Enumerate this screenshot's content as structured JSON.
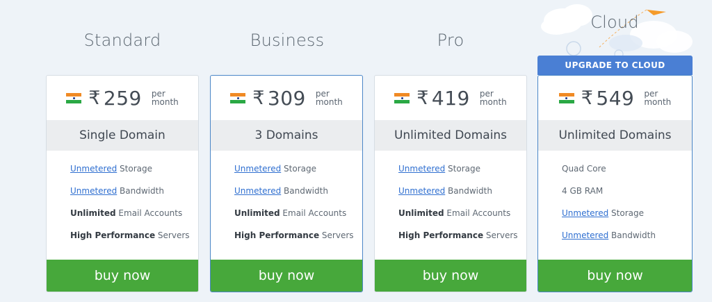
{
  "plans": [
    {
      "title": "Standard",
      "price": "259",
      "currency": "₹",
      "per_line1": "per",
      "per_line2": "month",
      "domains": "Single Domain",
      "features": [
        {
          "em": "Unmetered",
          "rest": " Storage",
          "style": "link"
        },
        {
          "em": "Unmetered",
          "rest": " Bandwidth",
          "style": "link"
        },
        {
          "em": "Unlimited",
          "rest": " Email Accounts",
          "style": "bold"
        },
        {
          "em": "High Performance",
          "rest": " Servers",
          "style": "bold"
        }
      ],
      "button": "buy now"
    },
    {
      "title": "Business",
      "price": "309",
      "currency": "₹",
      "per_line1": "per",
      "per_line2": "month",
      "domains": "3 Domains",
      "features": [
        {
          "em": "Unmetered",
          "rest": " Storage",
          "style": "link"
        },
        {
          "em": "Unmetered",
          "rest": " Bandwidth",
          "style": "link"
        },
        {
          "em": "Unlimited",
          "rest": " Email Accounts",
          "style": "bold"
        },
        {
          "em": "High Performance",
          "rest": " Servers",
          "style": "bold"
        }
      ],
      "button": "buy now"
    },
    {
      "title": "Pro",
      "price": "419",
      "currency": "₹",
      "per_line1": "per",
      "per_line2": "month",
      "domains": "Unlimited Domains",
      "features": [
        {
          "em": "Unmetered",
          "rest": " Storage",
          "style": "link"
        },
        {
          "em": "Unmetered",
          "rest": " Bandwidth",
          "style": "link"
        },
        {
          "em": "Unlimited",
          "rest": " Email Accounts",
          "style": "bold"
        },
        {
          "em": "High Performance",
          "rest": " Servers",
          "style": "bold"
        }
      ],
      "button": "buy now"
    },
    {
      "title": "Cloud",
      "price": "549",
      "currency": "₹",
      "per_line1": "per",
      "per_line2": "month",
      "domains": "Unlimited Domains",
      "features": [
        {
          "em": "",
          "rest": "Quad Core",
          "style": "plain"
        },
        {
          "em": "",
          "rest": "4 GB RAM",
          "style": "plain"
        },
        {
          "em": "Unmetered",
          "rest": " Storage",
          "style": "link"
        },
        {
          "em": "Unmetered",
          "rest": " Bandwidth",
          "style": "link"
        }
      ],
      "button": "buy now"
    }
  ],
  "upgrade_banner": "UPGRADE TO CLOUD",
  "colors": {
    "buy_green": "#47a83b",
    "link_blue": "#2f6fd0",
    "banner_blue": "#4a7fd4",
    "selected_border": "#4a86c7"
  }
}
